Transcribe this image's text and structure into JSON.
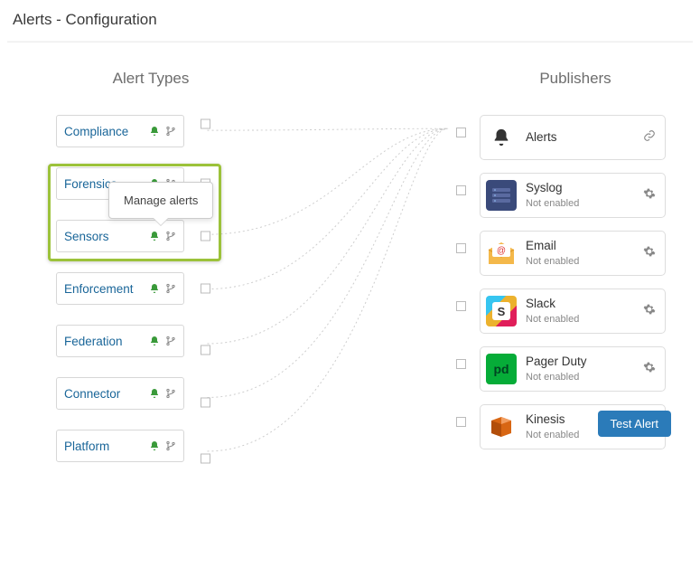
{
  "page": {
    "title": "Alerts - Configuration"
  },
  "tooltip": {
    "text": "Manage alerts"
  },
  "columns": {
    "left_header": "Alert Types",
    "right_header": "Publishers"
  },
  "alert_types": [
    {
      "name": "Compliance"
    },
    {
      "name": "Forensics"
    },
    {
      "name": "Sensors"
    },
    {
      "name": "Enforcement"
    },
    {
      "name": "Federation"
    },
    {
      "name": "Connector"
    },
    {
      "name": "Platform"
    }
  ],
  "publishers": [
    {
      "name": "Alerts",
      "status": "",
      "icon": "bell",
      "action": "link"
    },
    {
      "name": "Syslog",
      "status": "Not enabled",
      "icon": "syslog",
      "action": "gear"
    },
    {
      "name": "Email",
      "status": "Not enabled",
      "icon": "email",
      "action": "gear"
    },
    {
      "name": "Slack",
      "status": "Not enabled",
      "icon": "slack",
      "action": "gear"
    },
    {
      "name": "Pager Duty",
      "status": "Not enabled",
      "icon": "pagerduty",
      "action": "gear"
    },
    {
      "name": "Kinesis",
      "status": "Not enabled",
      "icon": "kinesis",
      "action": "gear"
    }
  ],
  "buttons": {
    "test_alert": "Test Alert"
  },
  "colors": {
    "link": "#1a6699",
    "highlight": "#9cc23a",
    "primary_button": "#2b7bb9"
  }
}
